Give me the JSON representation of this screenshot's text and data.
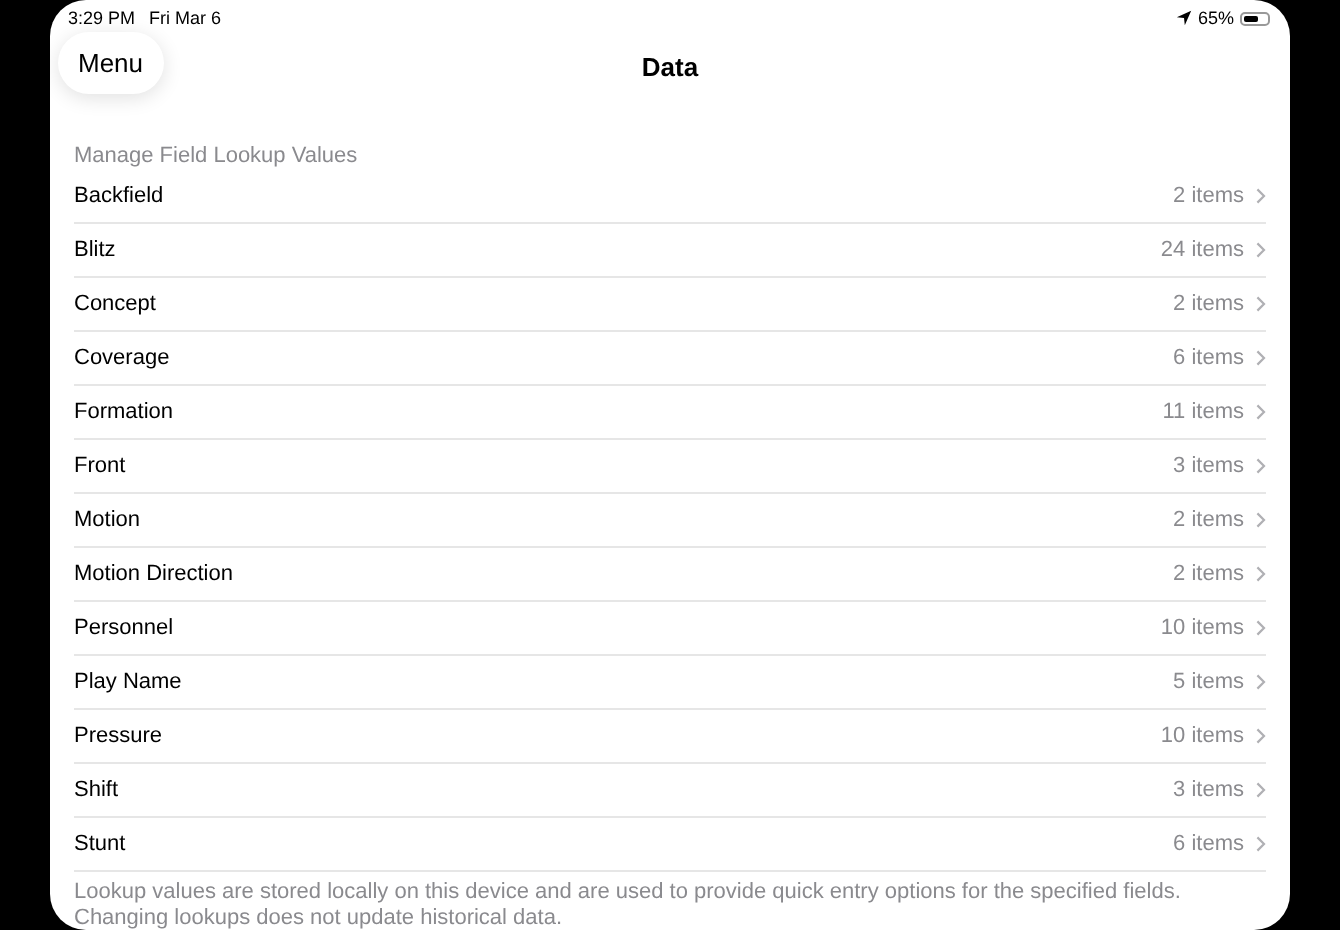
{
  "status_bar": {
    "time": "3:29 PM",
    "date": "Fri Mar 6",
    "battery": "65%"
  },
  "nav": {
    "menu_button": "Menu",
    "title": "Data"
  },
  "section": {
    "header": "Manage Field Lookup Values",
    "rows": [
      {
        "label": "Backfield",
        "count": "2 items"
      },
      {
        "label": "Blitz",
        "count": "24 items"
      },
      {
        "label": "Concept",
        "count": "2 items"
      },
      {
        "label": "Coverage",
        "count": "6 items"
      },
      {
        "label": "Formation",
        "count": "11 items"
      },
      {
        "label": "Front",
        "count": "3 items"
      },
      {
        "label": "Motion",
        "count": "2 items"
      },
      {
        "label": "Motion Direction",
        "count": "2 items"
      },
      {
        "label": "Personnel",
        "count": "10 items"
      },
      {
        "label": "Play Name",
        "count": "5 items"
      },
      {
        "label": "Pressure",
        "count": "10 items"
      },
      {
        "label": "Shift",
        "count": "3 items"
      },
      {
        "label": "Stunt",
        "count": "6 items"
      }
    ],
    "footer": "Lookup values are stored locally on this device and are used to provide quick entry options for the specified fields. Changing lookups does not update historical data."
  }
}
